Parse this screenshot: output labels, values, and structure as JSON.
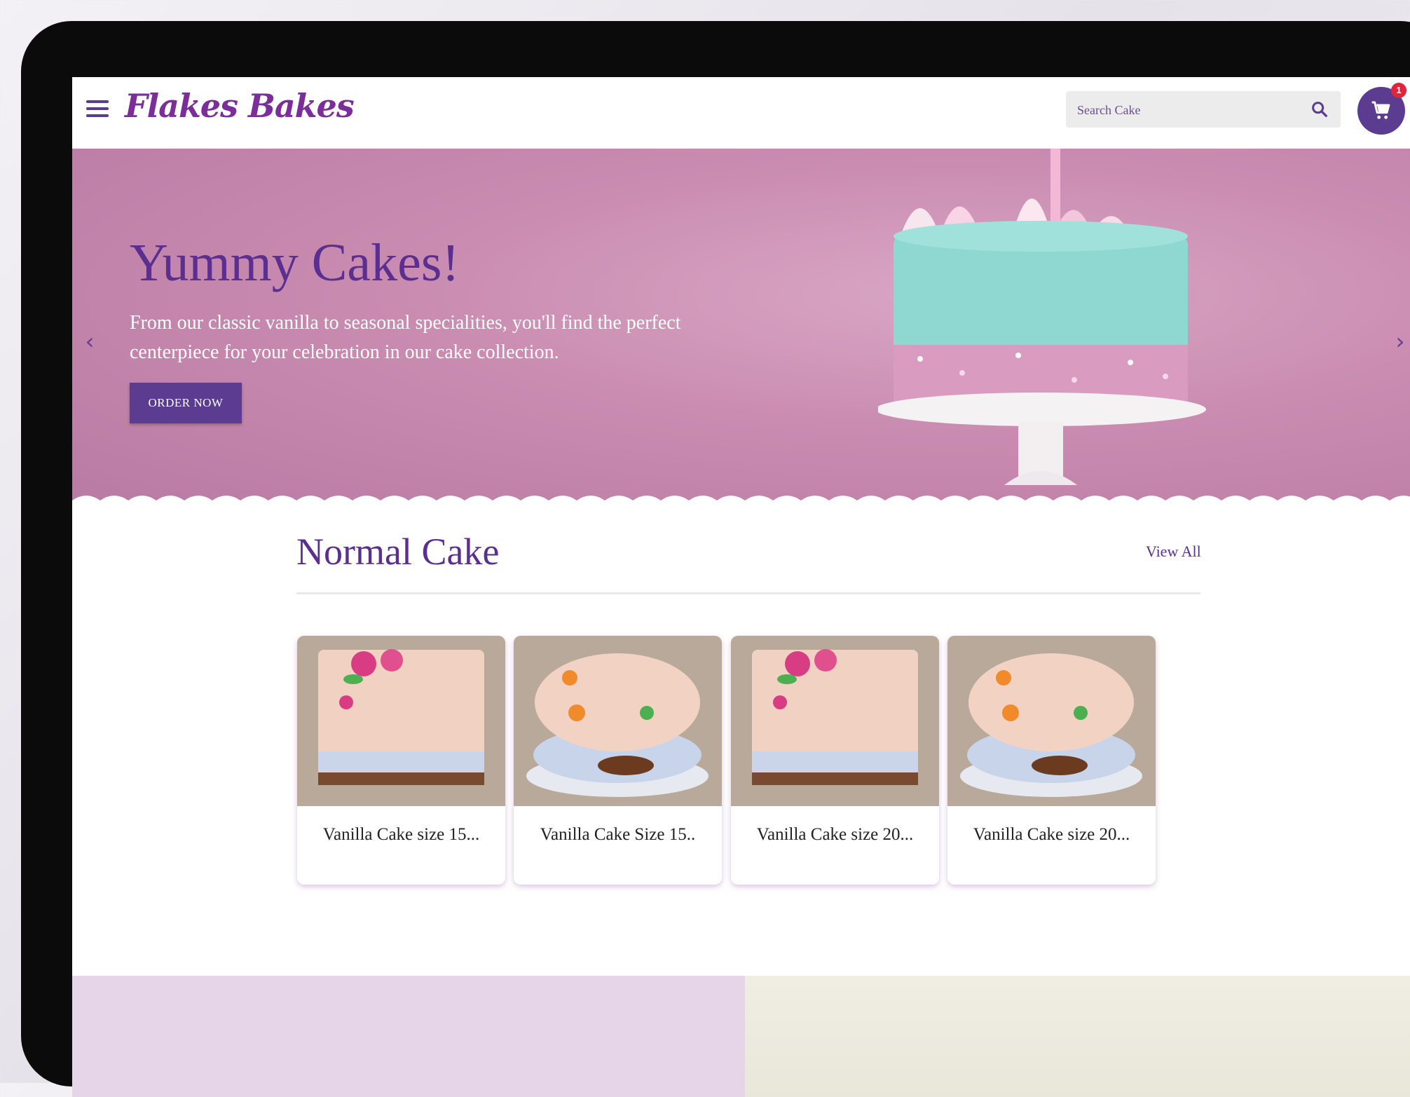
{
  "header": {
    "logo_text": "Flakes Bakes",
    "search_placeholder": "Search Cake",
    "cart_count": "1"
  },
  "hero": {
    "title": "Yummy Cakes!",
    "description": "From our classic vanilla to seasonal specialities, you'll find the perfect centerpiece for your celebration in our cake collection.",
    "order_button_label": "ORDER NOW",
    "prev_arrow": "‹",
    "next_arrow": "›"
  },
  "section": {
    "title": "Normal Cake",
    "view_all_label": "View All",
    "products": [
      {
        "title": "Vanilla Cake size 15...",
        "shape": "square"
      },
      {
        "title": "Vanilla Cake Size 15..",
        "shape": "round"
      },
      {
        "title": "Vanilla Cake size 20...",
        "shape": "square"
      },
      {
        "title": "Vanilla Cake size 20...",
        "shape": "round"
      }
    ]
  },
  "colors": {
    "brand_purple": "#5b3c91",
    "title_purple": "#5b2f8f",
    "hero_pink": "#c98bb0",
    "badge_red": "#e3233a"
  }
}
